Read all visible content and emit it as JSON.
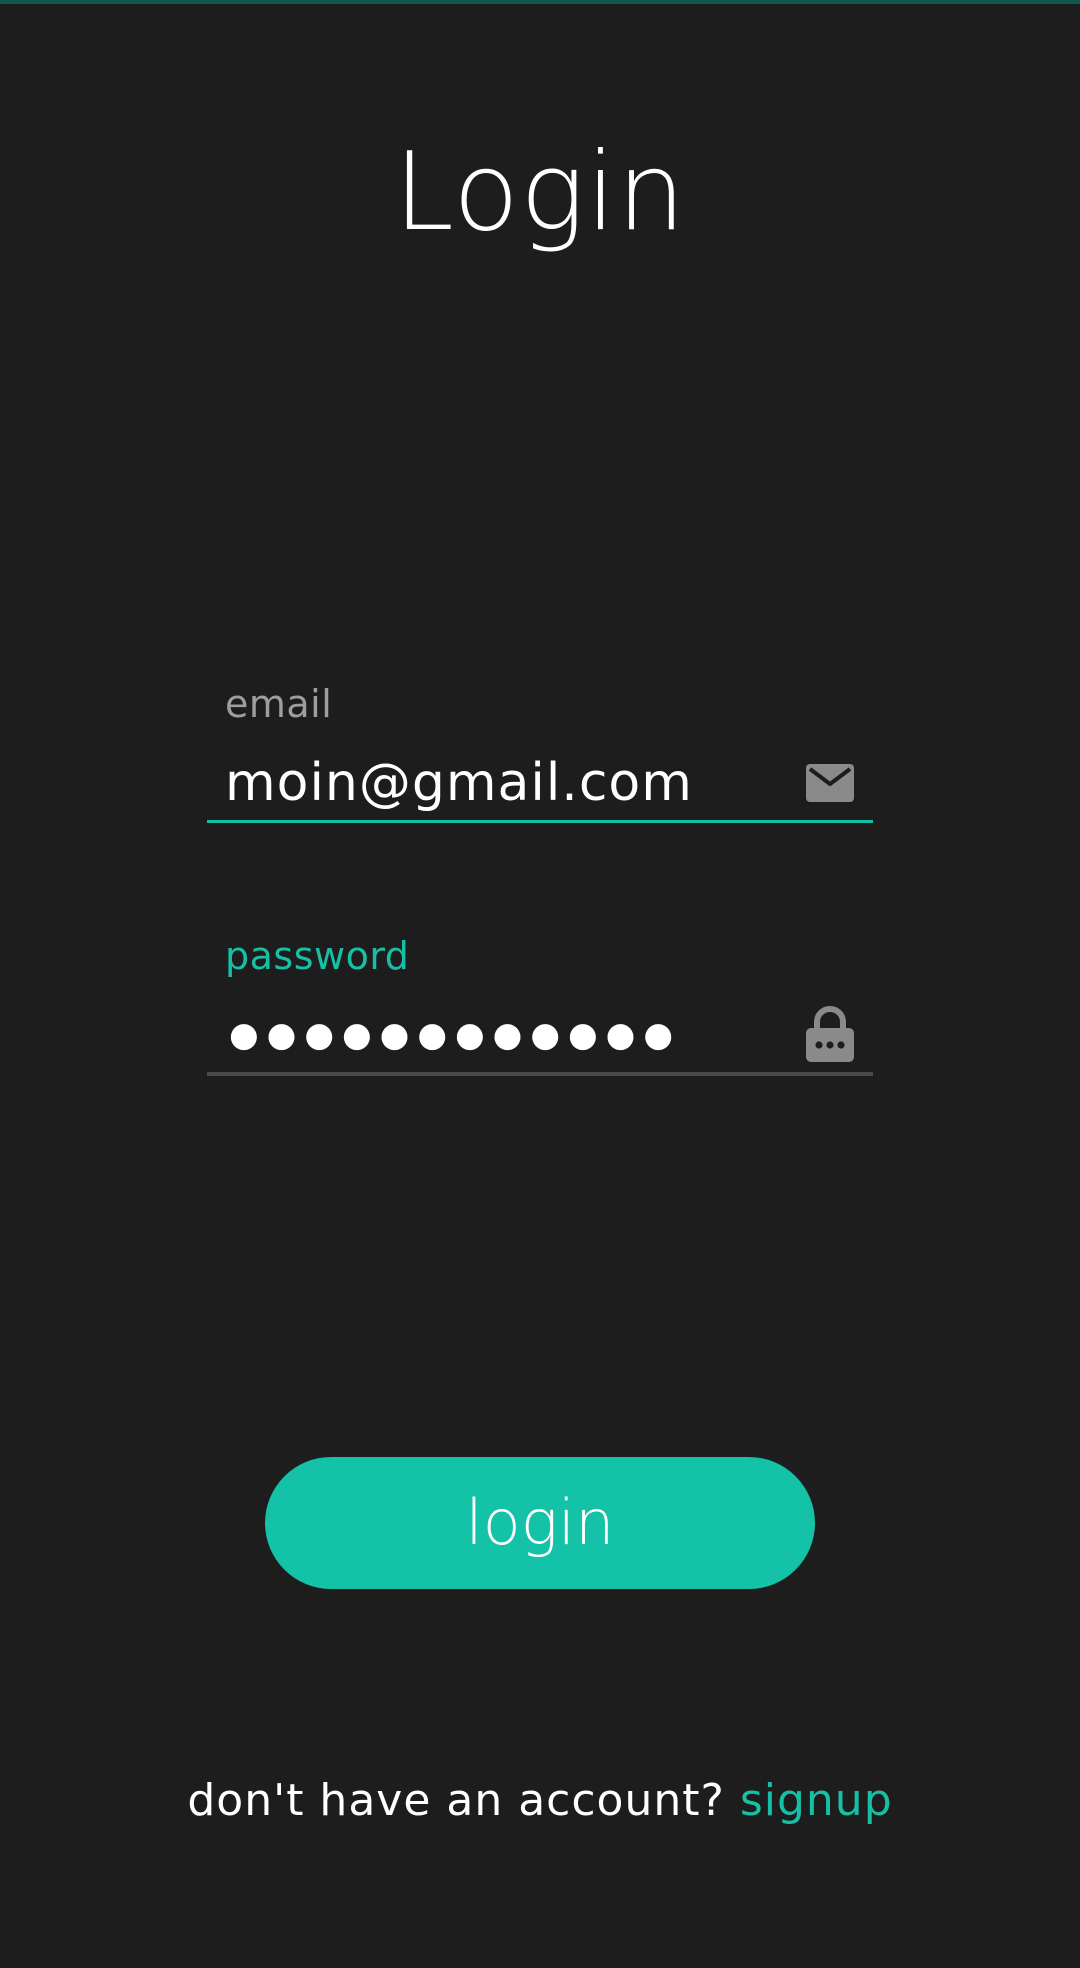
{
  "page": {
    "title": "Login"
  },
  "email_field": {
    "label": "email",
    "value": "moin@gmail.com",
    "icon": "envelope-icon"
  },
  "password_field": {
    "label": "password",
    "masked_value": "●●●●●●●●●●●●",
    "icon": "lock-icon"
  },
  "login_button": {
    "label": "login"
  },
  "footer": {
    "prompt": "don't have an account? ",
    "link_label": "signup"
  },
  "colors": {
    "background": "#1e1d1e",
    "accent": "#17bfa4",
    "button": "#14c2a8",
    "muted_label": "#9e9e9e",
    "icon": "#8a8a8a"
  }
}
